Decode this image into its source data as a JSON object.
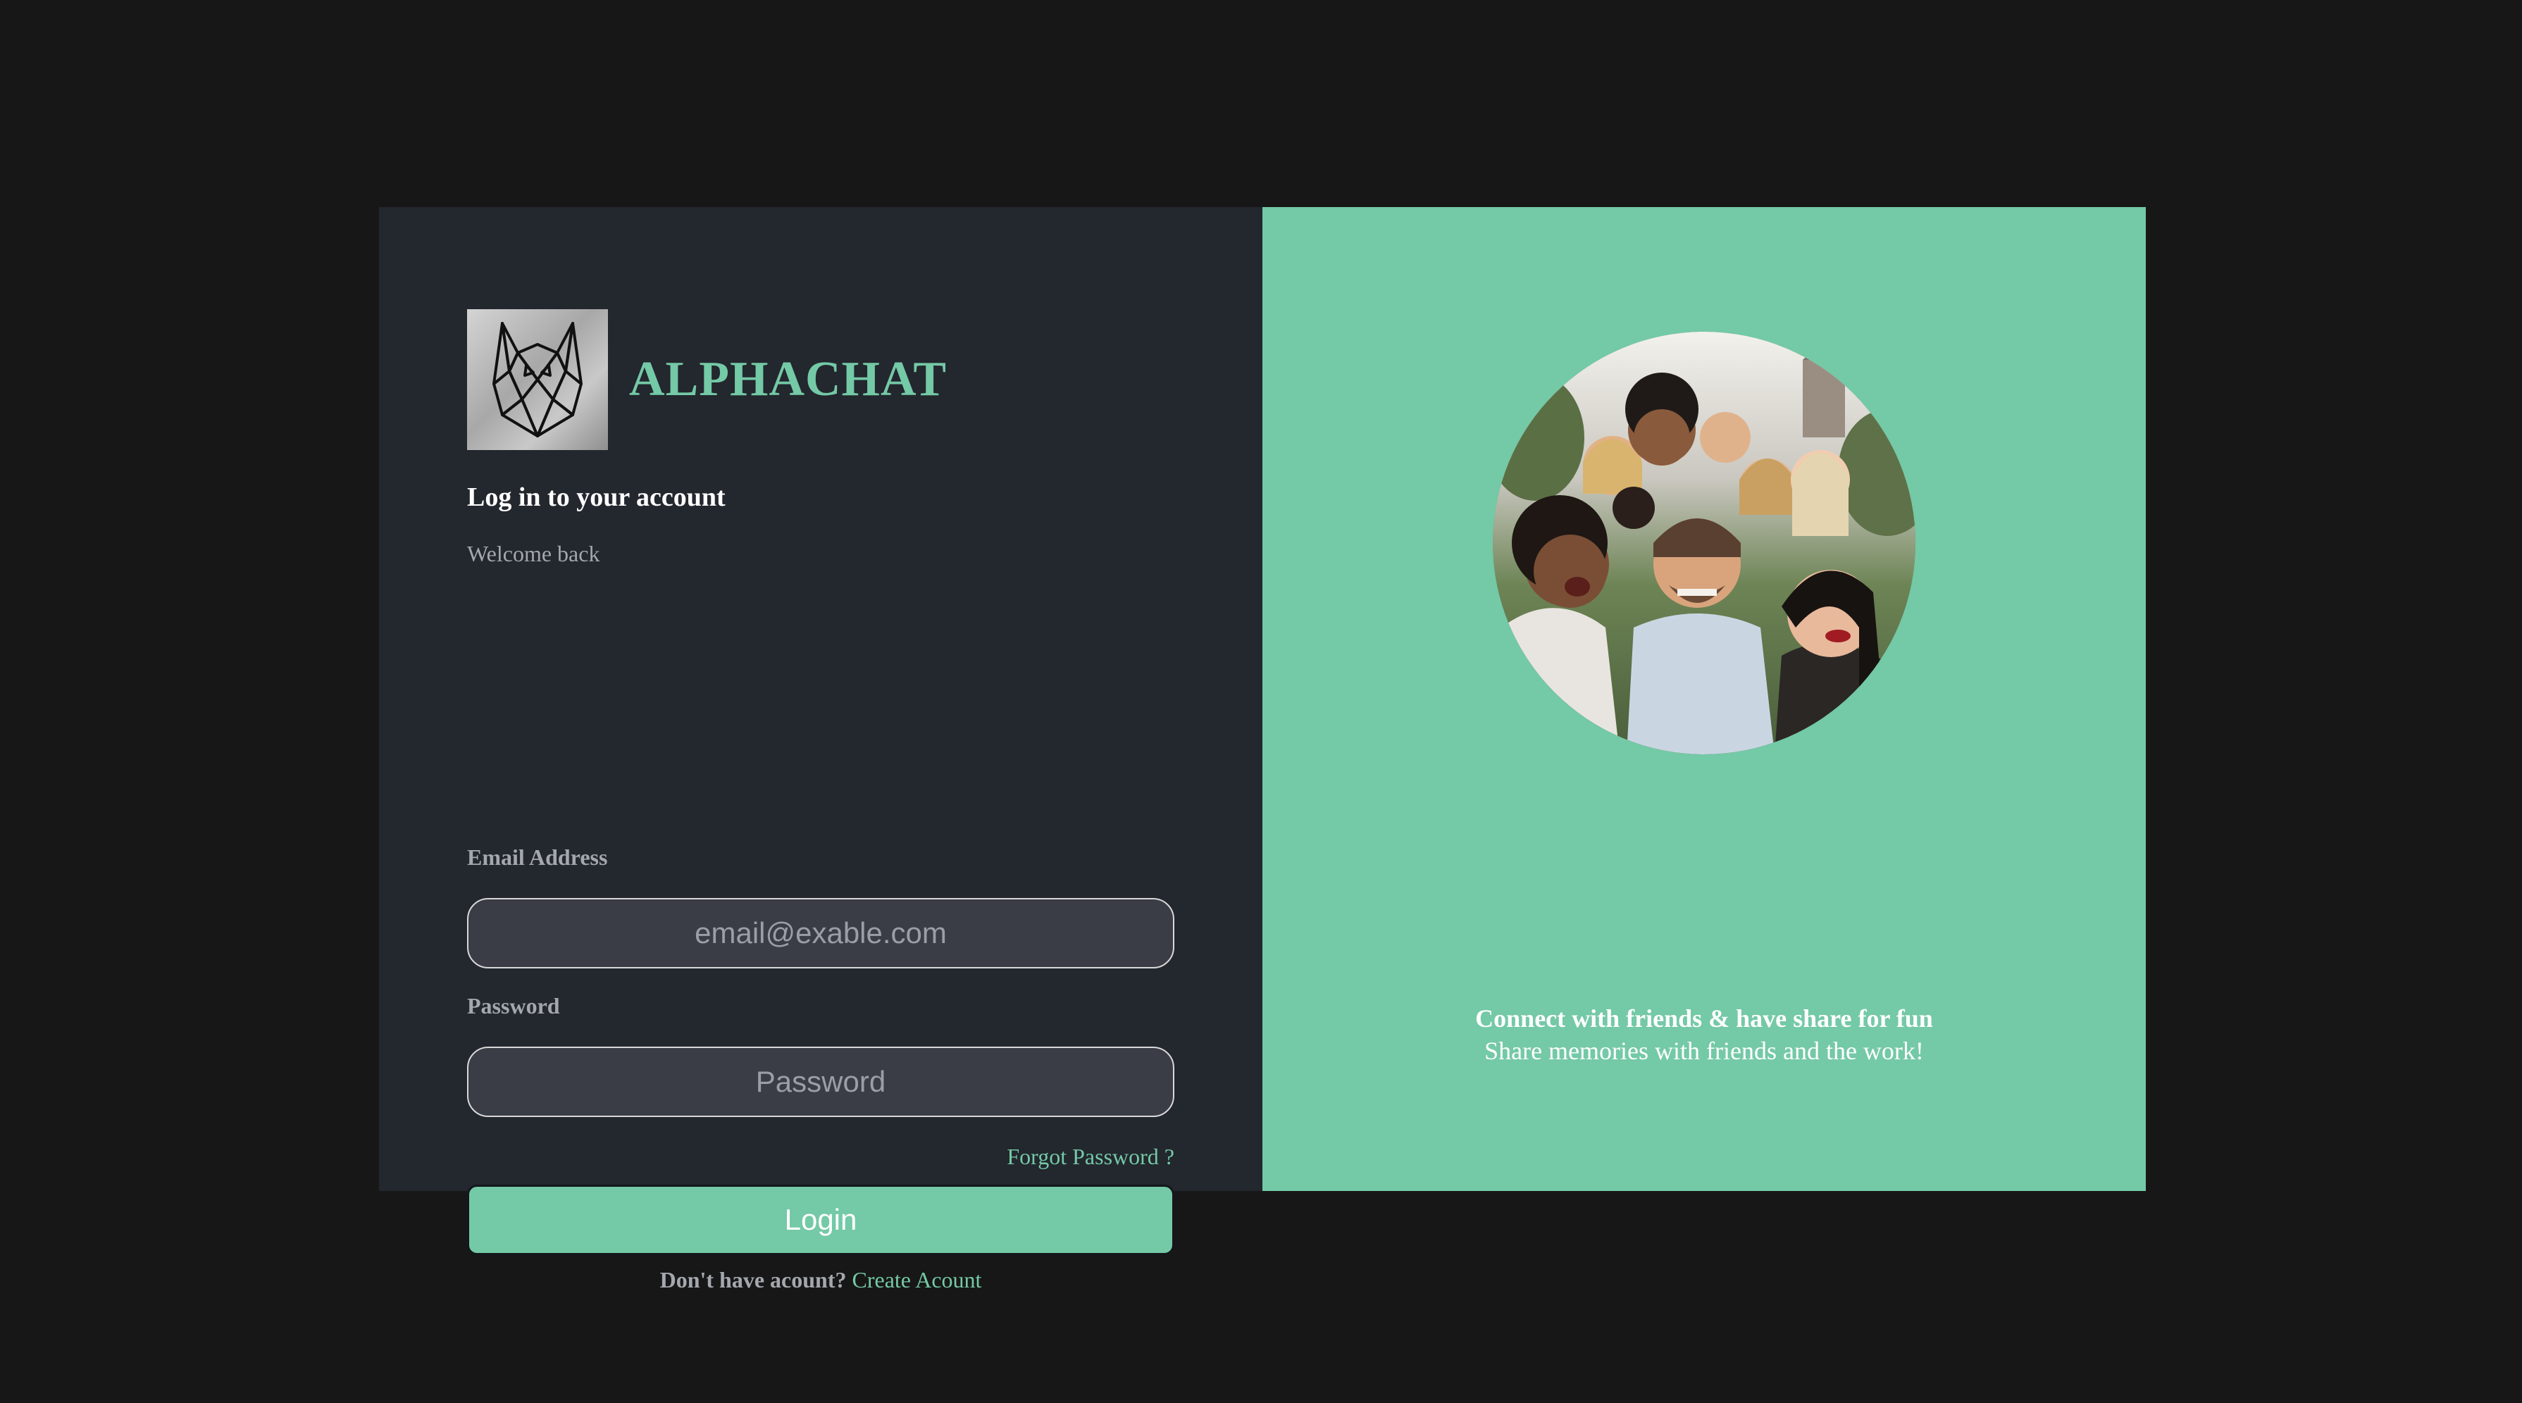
{
  "brand": {
    "name": "ALPHACHAT",
    "logo_icon": "geometric-wolf-icon"
  },
  "login": {
    "title": "Log in to your account",
    "subtitle": "Welcome back",
    "email_label": "Email Address",
    "email_placeholder": "email@exable.com",
    "password_label": "Password",
    "password_placeholder": "Password",
    "forgot_password": "Forgot Password ?",
    "login_button": "Login",
    "signup_prompt": "Don't have acount?",
    "signup_link": "Create Acount"
  },
  "promo": {
    "title": "Connect with friends & have share for fun",
    "subtitle": "Share memories with friends and the work!"
  },
  "colors": {
    "page_background": "#171717",
    "panel_background": "#23272e",
    "accent": "#74c9a6",
    "input_background": "#3a3d45"
  }
}
